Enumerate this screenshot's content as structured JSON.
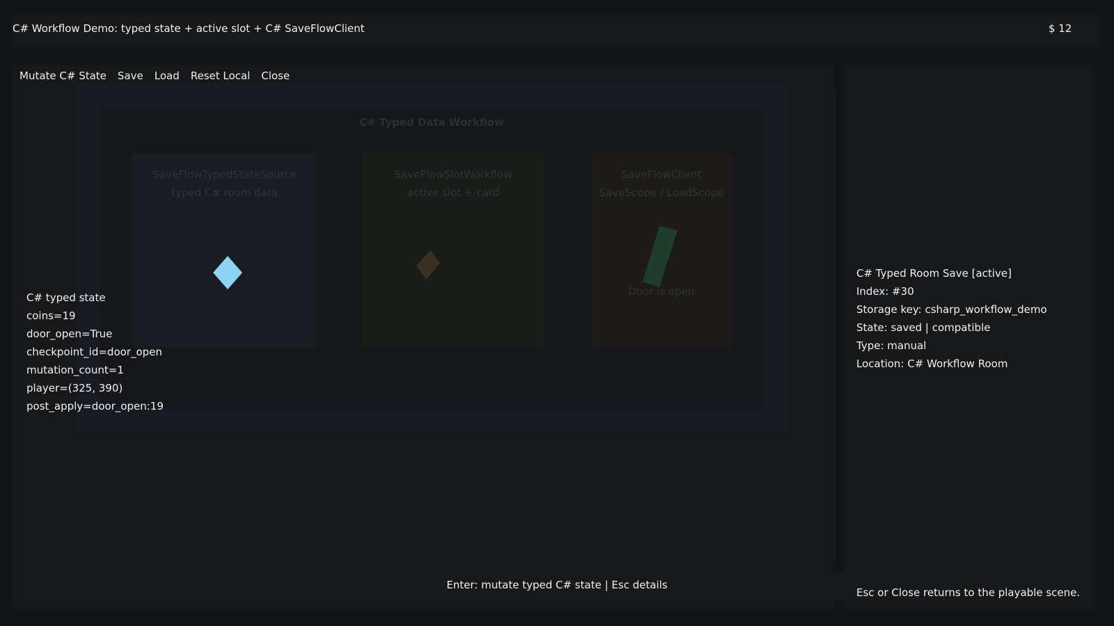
{
  "header": {
    "title": "C# Workflow Demo: typed state + active slot + C# SaveFlowClient",
    "currency": "$ 12"
  },
  "menu": {
    "items": [
      "Mutate C# State",
      "Save",
      "Load",
      "Reset Local",
      "Close"
    ]
  },
  "room": {
    "title": "C# Typed Data Workflow",
    "cards": [
      {
        "line1": "SaveFlowTypedStateSource",
        "line2": "typed C# room data"
      },
      {
        "line1": "SaveFlowSlotWorkflow",
        "line2": "active slot + card"
      },
      {
        "line1": "SaveFlowClient",
        "line2": "SaveScope / LoadScope"
      }
    ],
    "door_text": "Door is open"
  },
  "state": {
    "lines": [
      "C# typed state",
      "coins=19",
      "door_open=True",
      "checkpoint_id=door_open",
      "mutation_count=1",
      "player=(325, 390)",
      "post_apply=door_open:19"
    ]
  },
  "slot": {
    "lines": [
      "C# Typed Room Save [active]",
      "Index: #30",
      "Storage key: csharp_workflow_demo",
      "State: saved | compatible",
      "Type: manual",
      "Location: C# Workflow Room"
    ]
  },
  "hint": "Enter: mutate typed C# state | Esc details",
  "footer": "Esc or Close returns to the playable scene.",
  "colors": {
    "player_gem": "#8fd3f4",
    "coin_gem": "#3a3220",
    "door_bar": "#1f3d2a"
  },
  "icons": {
    "player": "diamond-icon",
    "coin": "diamond-icon",
    "door": "door-bar-icon"
  }
}
